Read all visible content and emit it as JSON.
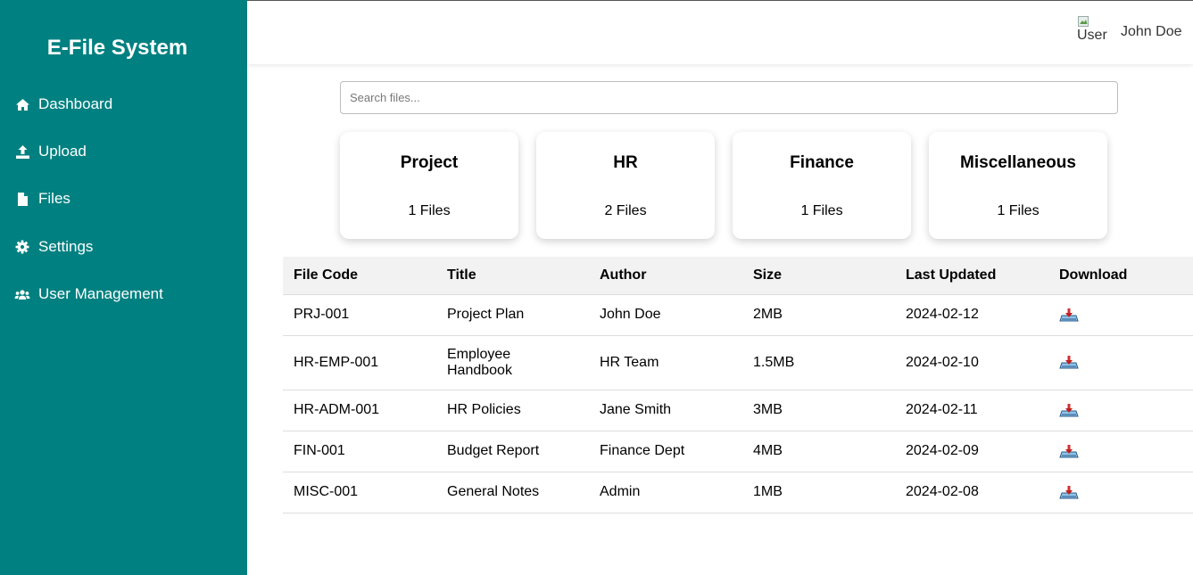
{
  "sidebar": {
    "brand": "E-File System",
    "items": [
      {
        "label": "Dashboard",
        "icon": "home-icon"
      },
      {
        "label": "Upload",
        "icon": "upload-icon"
      },
      {
        "label": "Files",
        "icon": "file-icon"
      },
      {
        "label": "Settings",
        "icon": "gear-icon"
      },
      {
        "label": "User Management",
        "icon": "users-icon"
      }
    ],
    "background": "#008080"
  },
  "header": {
    "avatar_alt": "User",
    "username": "John Doe"
  },
  "search": {
    "placeholder": "Search files...",
    "value": ""
  },
  "categories": [
    {
      "name": "Project",
      "count": "1 Files"
    },
    {
      "name": "HR",
      "count": "2 Files"
    },
    {
      "name": "Finance",
      "count": "1 Files"
    },
    {
      "name": "Miscellaneous",
      "count": "1 Files"
    }
  ],
  "table": {
    "columns": [
      "File Code",
      "Title",
      "Author",
      "Size",
      "Last Updated",
      "Download"
    ],
    "rows": [
      {
        "code": "PRJ-001",
        "title": "Project Plan",
        "author": "John Doe",
        "size": "2MB",
        "updated": "2024-02-12"
      },
      {
        "code": "HR-EMP-001",
        "title": "Employee Handbook",
        "author": "HR Team",
        "size": "1.5MB",
        "updated": "2024-02-10"
      },
      {
        "code": "HR-ADM-001",
        "title": "HR Policies",
        "author": "Jane Smith",
        "size": "3MB",
        "updated": "2024-02-11"
      },
      {
        "code": "FIN-001",
        "title": "Budget Report",
        "author": "Finance Dept",
        "size": "4MB",
        "updated": "2024-02-09"
      },
      {
        "code": "MISC-001",
        "title": "General Notes",
        "author": "Admin",
        "size": "1MB",
        "updated": "2024-02-08"
      }
    ]
  }
}
